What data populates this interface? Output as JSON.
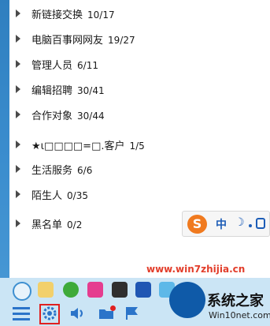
{
  "groups": [
    {
      "name": "新链接交换",
      "count": "10/17"
    },
    {
      "name": "电脑百事网网友",
      "count": "19/27"
    },
    {
      "name": "管理人员",
      "count": "6/11"
    },
    {
      "name": "编辑招聘",
      "count": "30/41"
    },
    {
      "name": "合作对象",
      "count": "30/44"
    },
    {
      "name": "★ι□□□□=□.客户",
      "count": "1/5"
    },
    {
      "name": "生活服务",
      "count": "6/6"
    },
    {
      "name": "陌生人",
      "count": "0/35"
    },
    {
      "name": "黑名单",
      "count": "0/2"
    }
  ],
  "ime": {
    "logo": "S",
    "mode": "中",
    "punct": "☽"
  },
  "watermark": "www.win7zhijia.cn",
  "site_logo": {
    "title": "系统之家",
    "url": "Win10net.com"
  },
  "colors": {
    "accent_red": "#e02020",
    "taskbar": "#cbe5f5",
    "ime_orange": "#f07a1f"
  }
}
